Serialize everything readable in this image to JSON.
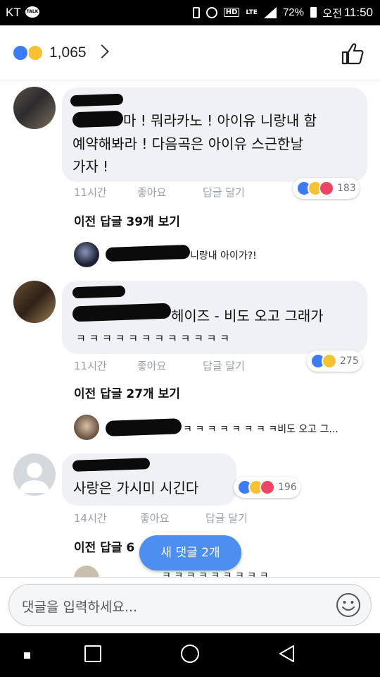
{
  "status_bar": {
    "carrier": "KT",
    "talk_badge": "TALK",
    "hd_badge": "HD",
    "network": "LTE",
    "battery": "72%",
    "ampm": "오전",
    "time": "11:50"
  },
  "header": {
    "reaction_count": "1,065",
    "icons": [
      "like-reaction-icon",
      "haha-reaction-icon",
      "chevron-right-icon",
      "thumbs-up-icon"
    ]
  },
  "comments": [
    {
      "text_line1": "마 ! 뭐라카노 ! 아이유 니랑내 함",
      "text_line2": "예약해봐라 ! 다음곡은 아이유 스근한날",
      "text_line3": "가자 !",
      "time": "11시간",
      "like": "좋아요",
      "reply": "답글 달기",
      "reaction_total": "183",
      "previous_replies": "이전 답글 39개 보기",
      "last_reply": "니랑내 아이가?!"
    },
    {
      "text_line1": "헤이즈 - 비도 오고 그래가",
      "text_line2": "ㅋ ㅋ ㅋ ㅋ ㅋ ㅋ ㅋ ㅋ ㅋ ㅋ ㅋ ㅋ",
      "time": "11시간",
      "like": "좋아요",
      "reply": "답글 달기",
      "reaction_total": "275",
      "previous_replies": "이전 답글 27개 보기",
      "last_reply": "ㅋ ㅋ ㅋ ㅋ ㅋ ㅋ ㅋ ㅋ비도 오고 그..."
    },
    {
      "text_line1": "사랑은 가시미 시긴다",
      "time": "14시간",
      "like": "좋아요",
      "reply": "답글 달기",
      "reaction_total": "196",
      "previous_replies": "이전 답글 6",
      "last_reply": "ㅋ ㅋ ㅋ ㅋ ㅋ ㅋ ㅋ ㅋ ㅋ"
    }
  ],
  "new_comments_button": "새 댓글 2개",
  "composer": {
    "placeholder": "댓글을 입력하세요..."
  },
  "colors": {
    "facebook_blue": "#4c8ff0",
    "like_blue": "#3b7cf4",
    "haha_yellow": "#f7c232",
    "love_red": "#ef4466"
  }
}
